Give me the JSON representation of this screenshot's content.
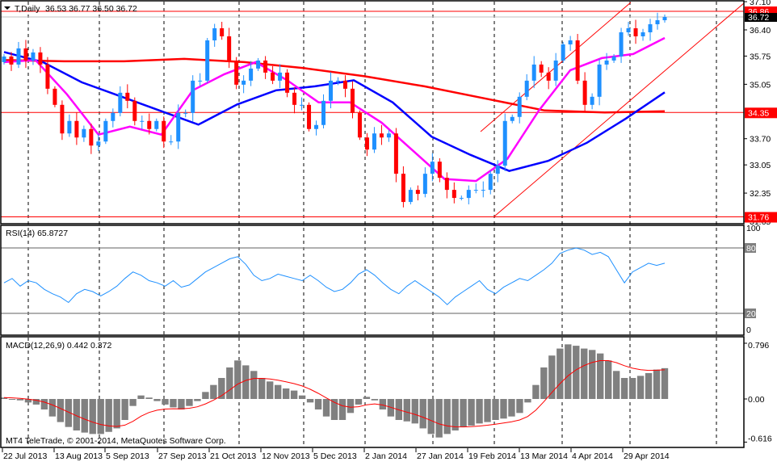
{
  "header": {
    "symbol_label": "T,Daily",
    "ohlc": "36.53 36.77 36.50 36.72"
  },
  "colors": {
    "up": "#1E90FF",
    "down": "#FF0000",
    "ma_fast": "#FF00FF",
    "ma_mid": "#0000FF",
    "ma_slow": "#FF0000",
    "level": "#FF0000",
    "bid": "#C0C0C0",
    "rsi": "#1E90FF",
    "hist": "#808080",
    "signal": "#FF0000"
  },
  "price_axis": {
    "ticks": [
      "37.10",
      "36.40",
      "35.75",
      "35.05",
      "33.70",
      "33.05",
      "32.35",
      "31.65"
    ]
  },
  "levels": [
    {
      "value": 36.86,
      "label": "36.86"
    },
    {
      "value": 34.35,
      "label": "34.35"
    },
    {
      "value": 31.76,
      "label": "31.76"
    }
  ],
  "bid": {
    "value": 36.72,
    "label": "36.72"
  },
  "rsi": {
    "title": "RSI(14) 65.8727",
    "ticks": [
      "100",
      "80",
      "20",
      "0"
    ],
    "levels": [
      80,
      20
    ],
    "values": [
      48,
      52,
      45,
      50,
      48,
      42,
      38,
      35,
      30,
      38,
      42,
      40,
      36,
      40,
      45,
      52,
      58,
      55,
      50,
      48,
      45,
      50,
      44,
      46,
      52,
      58,
      62,
      66,
      70,
      72,
      65,
      55,
      50,
      52,
      56,
      54,
      52,
      50,
      55,
      50,
      44,
      40,
      42,
      48,
      56,
      60,
      55,
      48,
      42,
      38,
      45,
      50,
      45,
      40,
      35,
      28,
      35,
      40,
      45,
      50,
      42,
      38,
      44,
      48,
      52,
      50,
      55,
      60,
      66,
      75,
      78,
      80,
      78,
      74,
      76,
      72,
      60,
      48,
      58,
      62,
      66,
      64,
      66
    ]
  },
  "macd": {
    "title": "MACD(12,26,9) 0.442 0.372",
    "ticks": [
      "0.796",
      "0.00",
      "-0.616"
    ],
    "hist": [
      0.02,
      0,
      -0.02,
      -0.05,
      -0.08,
      -0.15,
      -0.25,
      -0.33,
      -0.4,
      -0.45,
      -0.48,
      -0.5,
      -0.5,
      -0.47,
      -0.42,
      -0.3,
      -0.1,
      0.05,
      0.02,
      -0.03,
      -0.08,
      -0.12,
      -0.15,
      -0.1,
      -0.03,
      0.1,
      0.2,
      0.3,
      0.45,
      0.55,
      0.48,
      0.4,
      0.3,
      0.25,
      0.2,
      0.15,
      0.12,
      0.05,
      -0.05,
      -0.15,
      -0.25,
      -0.3,
      -0.3,
      -0.2,
      -0.08,
      0.03,
      -0.02,
      -0.15,
      -0.25,
      -0.3,
      -0.32,
      -0.35,
      -0.42,
      -0.5,
      -0.55,
      -0.5,
      -0.45,
      -0.4,
      -0.38,
      -0.35,
      -0.33,
      -0.3,
      -0.28,
      -0.25,
      -0.2,
      -0.05,
      0.2,
      0.45,
      0.62,
      0.72,
      0.78,
      0.76,
      0.72,
      0.7,
      0.65,
      0.55,
      0.4,
      0.3,
      0.3,
      0.33,
      0.37,
      0.42,
      0.44
    ]
  },
  "copyright": "MT4 TeleTrade, © 2001-2014, MetaQuotes Software Corp.",
  "chart_data": {
    "type": "candlestick",
    "title": "T,Daily",
    "ylim": [
      31.65,
      37.1
    ],
    "x_tick_labels": [
      "22 Jul 2013",
      "13 Aug 2013",
      "5 Sep 2013",
      "27 Sep 2013",
      "21 Oct 2013",
      "12 Nov 2013",
      "5 Dec 2013",
      "2 Jan 2014",
      "27 Jan 2014",
      "19 Feb 2014",
      "13 Mar 2014",
      "4 Apr 2014",
      "29 Apr 2014"
    ],
    "closes": [
      35.74,
      35.54,
      35.94,
      35.64,
      35.84,
      35.54,
      34.94,
      34.54,
      33.83,
      34.14,
      33.73,
      33.94,
      33.53,
      33.63,
      34.14,
      34.34,
      34.84,
      34.64,
      34.14,
      34.14,
      33.94,
      34.14,
      33.63,
      33.63,
      34.34,
      34.34,
      35.14,
      35.14,
      36.14,
      36.44,
      36.24,
      35.64,
      35.04,
      35.14,
      35.44,
      35.64,
      35.34,
      35.14,
      35.34,
      34.84,
      34.54,
      34.54,
      33.94,
      34.04,
      34.64,
      35.14,
      35.14,
      34.94,
      34.34,
      33.73,
      33.43,
      33.83,
      33.73,
      33.83,
      32.83,
      32.13,
      32.43,
      32.33,
      32.83,
      33.13,
      32.73,
      32.43,
      32.23,
      32.23,
      32.43,
      32.43,
      32.43,
      32.83,
      33.03,
      34.14,
      34.24,
      34.74,
      35.14,
      35.54,
      35.34,
      35.14,
      35.64,
      36.04,
      36.14,
      35.14,
      34.54,
      34.74,
      35.54,
      35.64,
      35.74,
      36.34,
      36.44,
      36.24,
      36.34,
      36.54,
      36.64,
      36.72
    ],
    "series": [
      {
        "name": "MA fast",
        "values": [
          35.6,
          35.65,
          34.8,
          33.8,
          34.0,
          33.8,
          34.9,
          35.3,
          35.6,
          35.15,
          34.6,
          34.6,
          34.1,
          33.4,
          32.7,
          32.65,
          33.2,
          34.4,
          35.4,
          35.7,
          35.8,
          36.2
        ]
      },
      {
        "name": "MA medium",
        "values": [
          35.85,
          35.6,
          35.1,
          34.75,
          34.4,
          34.05,
          34.55,
          34.9,
          35.0,
          35.15,
          34.6,
          33.75,
          33.3,
          32.9,
          33.15,
          33.6,
          34.2,
          34.85
        ]
      },
      {
        "name": "MA slow",
        "values": [
          35.65,
          35.62,
          35.62,
          35.68,
          35.6,
          35.45,
          35.25,
          35.0,
          34.7,
          34.4,
          34.35,
          34.38
        ]
      }
    ]
  }
}
